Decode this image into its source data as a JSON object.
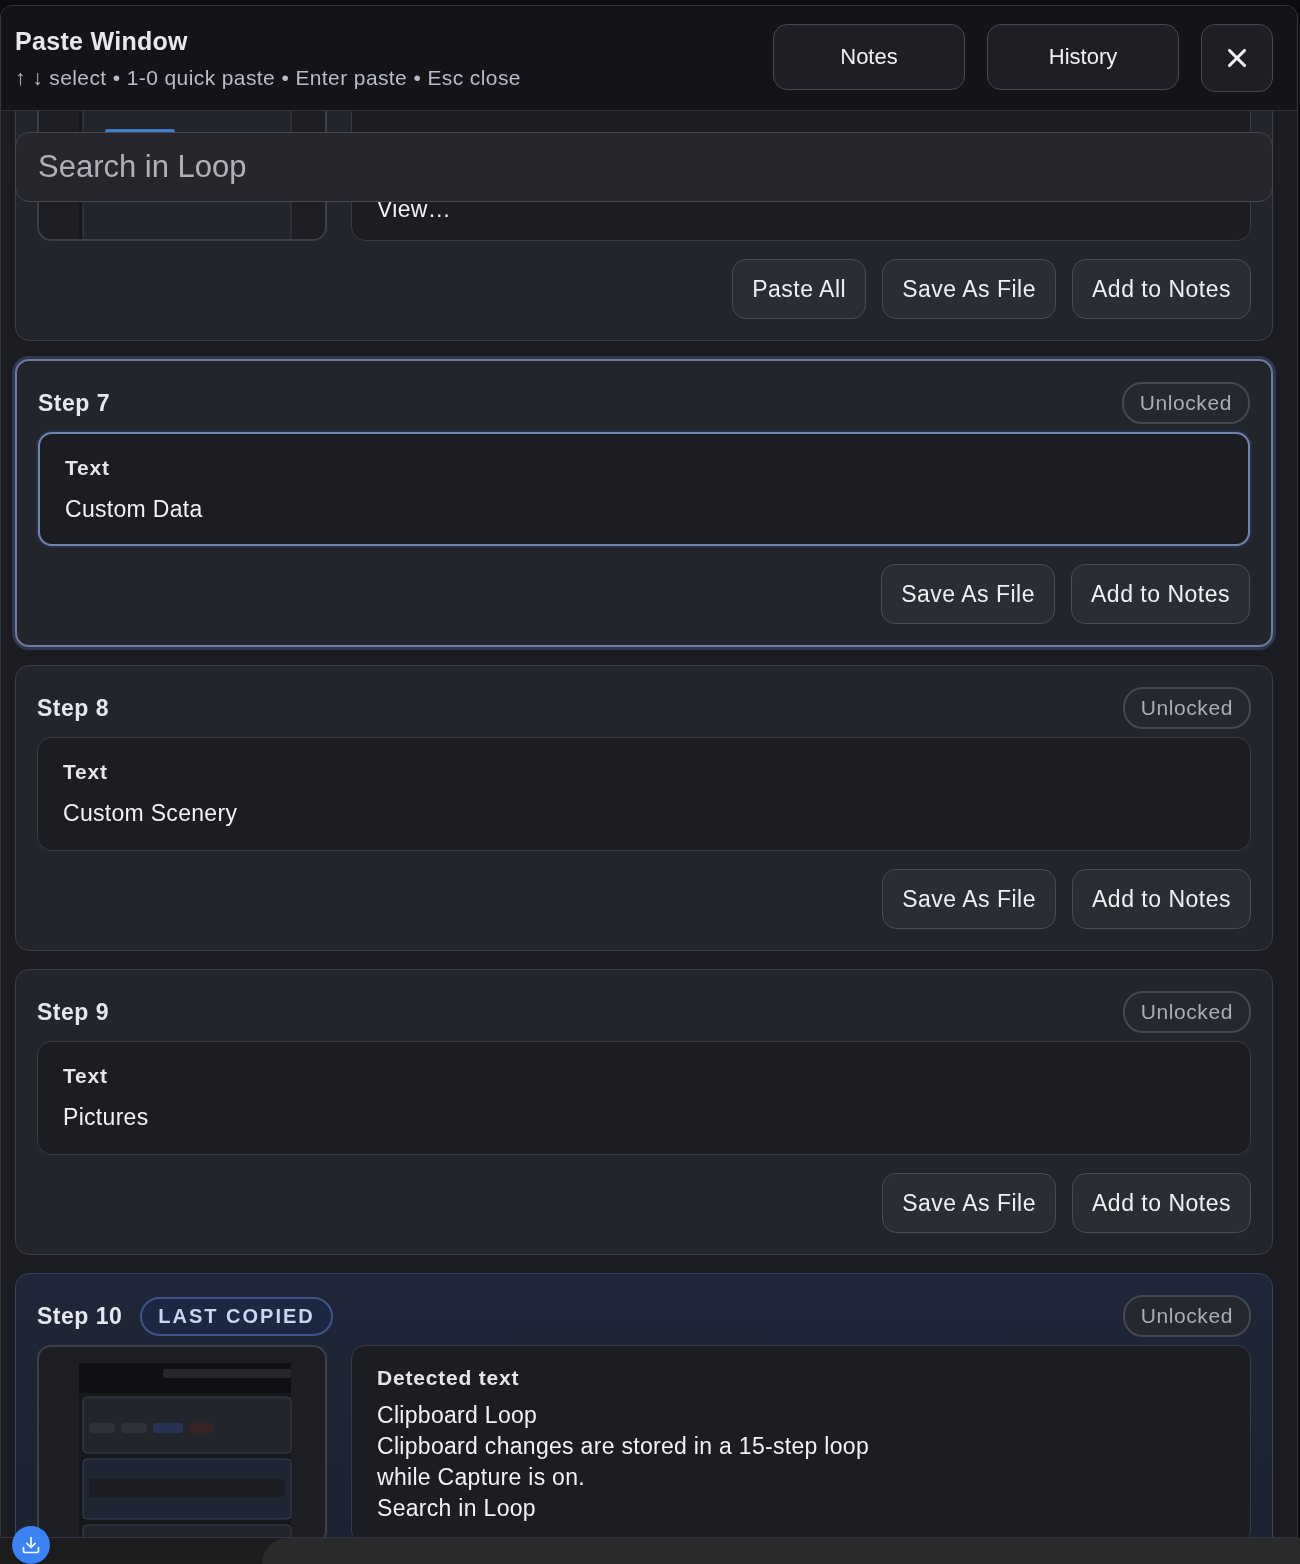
{
  "header": {
    "title": "Paste Window",
    "hint": "↑ ↓ select • 1-0 quick paste • Enter paste • Esc close",
    "buttons": [
      {
        "label": "Notes"
      },
      {
        "label": "History"
      }
    ]
  },
  "search": {
    "placeholder": "Search in Loop"
  },
  "steps": [
    {
      "kind": "image",
      "selected": false,
      "lines": [
        "View…"
      ],
      "actions": [
        "Paste All",
        "Save As File",
        "Add to Notes"
      ]
    },
    {
      "kind": "text",
      "title": "Step 7",
      "selected": true,
      "lock": "Unlocked",
      "content_label": "Text",
      "lines": [
        "Custom Data"
      ],
      "actions": [
        "Save As File",
        "Add to Notes"
      ]
    },
    {
      "kind": "text",
      "title": "Step 8",
      "selected": false,
      "lock": "Unlocked",
      "content_label": "Text",
      "lines": [
        "Custom Scenery"
      ],
      "actions": [
        "Save As File",
        "Add to Notes"
      ]
    },
    {
      "kind": "text",
      "title": "Step 9",
      "selected": false,
      "lock": "Unlocked",
      "content_label": "Text",
      "lines": [
        "Pictures"
      ],
      "actions": [
        "Save As File",
        "Add to Notes"
      ]
    },
    {
      "kind": "image",
      "title": "Step 10",
      "badge": "LAST COPIED",
      "selected": false,
      "lock": "Unlocked",
      "content_label": "Detected text",
      "lines": [
        "Clipboard Loop",
        "Clipboard changes are stored in a 15-step loop",
        "while Capture is on.",
        "Search in Loop"
      ]
    }
  ]
}
